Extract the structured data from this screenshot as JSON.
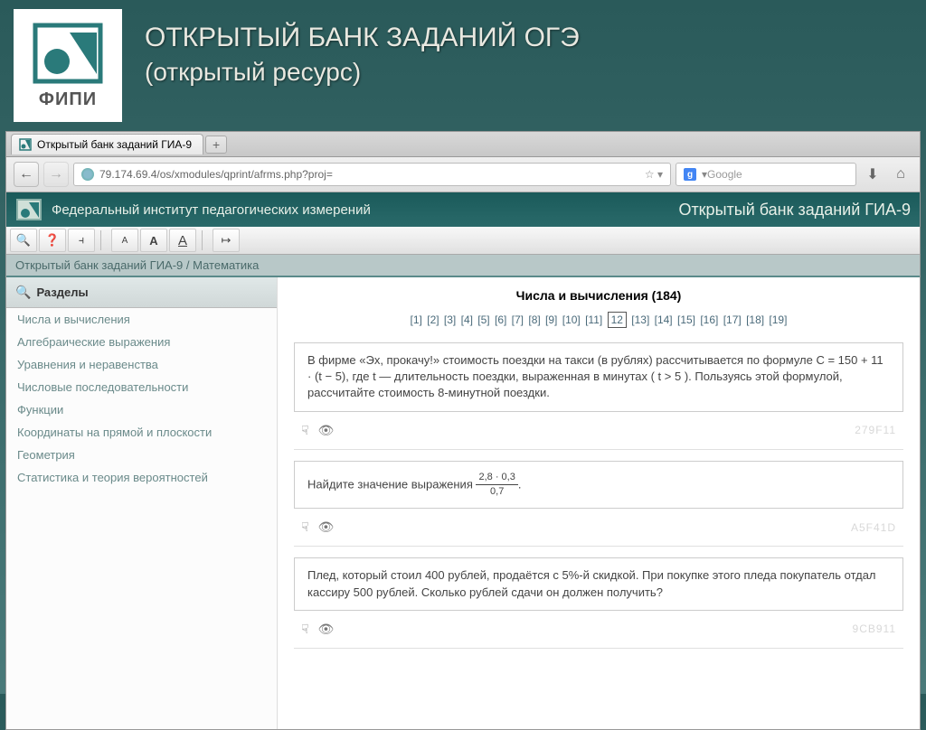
{
  "slide": {
    "title": "ОТКРЫТЫЙ БАНК ЗАДАНИЙ ОГЭ",
    "subtitle": "(открытый ресурс)",
    "logo_label": "ФИПИ"
  },
  "browser": {
    "tab_title": "Открытый банк заданий ГИА-9",
    "url": "79.174.69.4/os/xmodules/qprint/afrms.php?proj=",
    "search_placeholder": "Google"
  },
  "page": {
    "institute": "Федеральный институт педагогических измерений",
    "bank_title": "Открытый банк заданий ГИА-9",
    "breadcrumb": "Открытый банк заданий ГИА-9 / Математика"
  },
  "sidebar": {
    "heading": "Разделы",
    "items": [
      "Числа и вычисления",
      "Алгебраические выражения",
      "Уравнения и неравенства",
      "Числовые последовательности",
      "Функции",
      "Координаты на прямой и плоскости",
      "Геометрия",
      "Статистика и теория вероятностей"
    ]
  },
  "main": {
    "section_title": "Числа и вычисления (184)",
    "pages": [
      "[1]",
      "[2]",
      "[3]",
      "[4]",
      "[5]",
      "[6]",
      "[7]",
      "[8]",
      "[9]",
      "[10]",
      "[11]",
      "12",
      "[13]",
      "[14]",
      "[15]",
      "[16]",
      "[17]",
      "[18]",
      "[19]"
    ],
    "current_page_index": 11,
    "tasks": [
      {
        "text": "В фирме «Эх, прокачу!» стоимость поездки на такси (в рублях) рассчитывается по формуле C = 150 + 11 · (t − 5), где t — длительность поездки, выраженная в минутах ( t > 5 ). Пользуясь этой формулой, рассчитайте стоимость 8-минутной поездки.",
        "id": "279F11"
      },
      {
        "text_prefix": "Найдите значение выражения ",
        "frac_top": "2,8 · 0,3",
        "frac_bot": "0,7",
        "text_suffix": ".",
        "id": "A5F41D"
      },
      {
        "text": "Плед, который стоил 400 рублей, продаётся с 5%-й скидкой. При покупке этого пледа покупатель отдал кассиру 500 рублей. Сколько рублей сдачи он должен получить?",
        "id": "9CB911"
      }
    ]
  }
}
